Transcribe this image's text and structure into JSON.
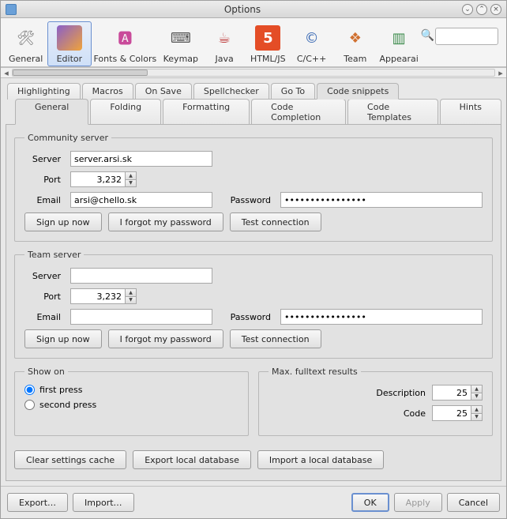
{
  "window": {
    "title": "Options"
  },
  "toolbar": {
    "categories": [
      {
        "label": "General",
        "icon": "wrench"
      },
      {
        "label": "Editor",
        "icon": "book"
      },
      {
        "label": "Fonts & Colors",
        "icon": "palette"
      },
      {
        "label": "Keymap",
        "icon": "keyboard"
      },
      {
        "label": "Java",
        "icon": "java"
      },
      {
        "label": "HTML/JS",
        "icon": "html5"
      },
      {
        "label": "C/C++",
        "icon": "c"
      },
      {
        "label": "Team",
        "icon": "cubes"
      },
      {
        "label": "Appearai",
        "icon": "columns"
      }
    ],
    "selected": "Editor",
    "search_placeholder": ""
  },
  "tabs_top": {
    "items": [
      "Highlighting",
      "Macros",
      "On Save",
      "Spellchecker",
      "Go To",
      "Code snippets"
    ],
    "selected": "Code snippets"
  },
  "tabs_second": {
    "items": [
      "General",
      "Folding",
      "Formatting",
      "Code Completion",
      "Code Templates",
      "Hints"
    ],
    "selected": "General"
  },
  "community": {
    "legend": "Community server",
    "server_label": "Server",
    "server_value": "server.arsi.sk",
    "port_label": "Port",
    "port_value": "3,232",
    "email_label": "Email",
    "email_value": "arsi@chello.sk",
    "password_label": "Password",
    "password_value": "••••••••••••••••",
    "signup": "Sign up now",
    "forgot": "I forgot my password",
    "test": "Test connection"
  },
  "team": {
    "legend": "Team server",
    "server_label": "Server",
    "server_value": "",
    "port_label": "Port",
    "port_value": "3,232",
    "email_label": "Email",
    "email_value": "",
    "password_label": "Password",
    "password_value": "••••••••••••••••",
    "signup": "Sign up now",
    "forgot": "I forgot my password",
    "test": "Test connection"
  },
  "show_on": {
    "legend": "Show on",
    "first": "first press",
    "second": "second press",
    "selected": "first"
  },
  "fulltext": {
    "legend": "Max. fulltext results",
    "description_label": "Description",
    "description_value": "25",
    "code_label": "Code",
    "code_value": "25"
  },
  "actions": {
    "clear": "Clear settings cache",
    "export_db": "Export local database",
    "import_db": "Import a local database"
  },
  "bottom": {
    "export": "Export…",
    "import": "Import…",
    "ok": "OK",
    "apply": "Apply",
    "cancel": "Cancel"
  }
}
